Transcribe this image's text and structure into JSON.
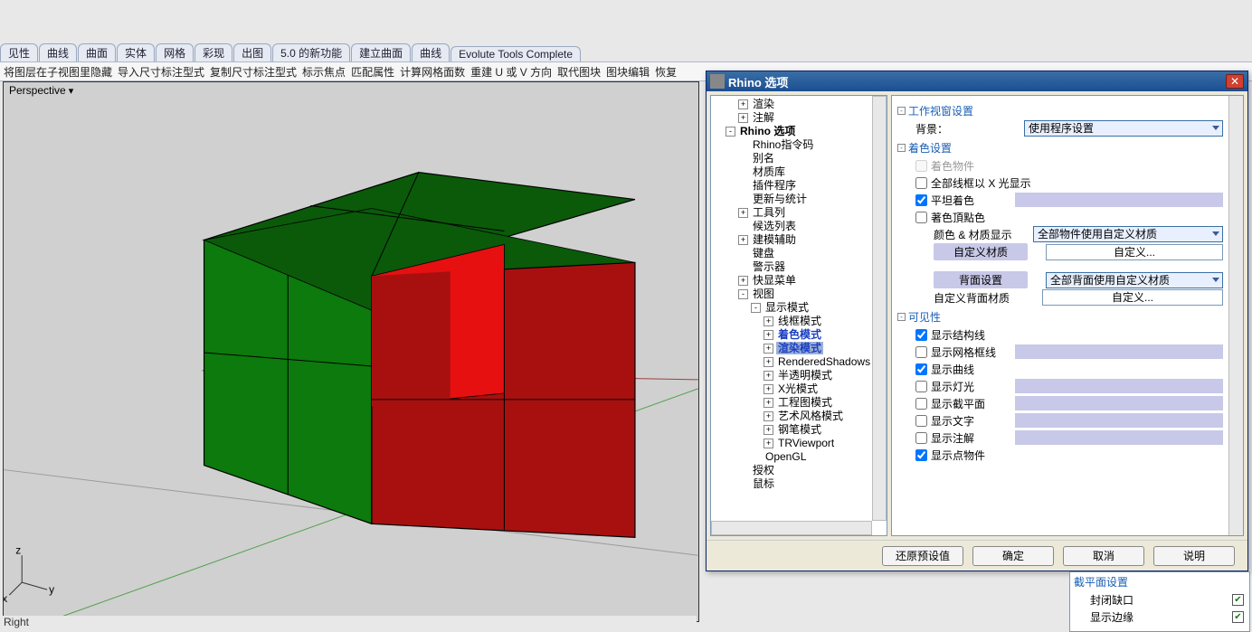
{
  "tabs": [
    "见性",
    "曲线",
    "曲面",
    "实体",
    "网格",
    "彩现",
    "出图",
    "5.0 的新功能",
    "建立曲面",
    "曲线",
    "Evolute Tools Complete"
  ],
  "toolbar": [
    "将图层在子视图里隐藏",
    "导入尺寸标注型式",
    "复制尺寸标注型式",
    "标示焦点",
    "匹配属性",
    "计算网格面数",
    "重建 U 或 V 方向",
    "取代图块",
    "图块编辑",
    "恢复"
  ],
  "viewport_label": "Perspective",
  "dialog": {
    "title": "Rhino 选项",
    "tree": [
      {
        "tw": "+",
        "label": "渲染",
        "depth": 2
      },
      {
        "tw": "+",
        "label": "注解",
        "depth": 2
      },
      {
        "tw": "-",
        "label": "Rhino 选项",
        "depth": 1,
        "bold": true
      },
      {
        "tw": " ",
        "label": "Rhino指令码",
        "depth": 2
      },
      {
        "tw": " ",
        "label": "别名",
        "depth": 2
      },
      {
        "tw": " ",
        "label": "材质库",
        "depth": 2
      },
      {
        "tw": " ",
        "label": "插件程序",
        "depth": 2
      },
      {
        "tw": " ",
        "label": "更新与统计",
        "depth": 2
      },
      {
        "tw": "+",
        "label": "工具列",
        "depth": 2
      },
      {
        "tw": " ",
        "label": "候选列表",
        "depth": 2
      },
      {
        "tw": "+",
        "label": "建模辅助",
        "depth": 2
      },
      {
        "tw": " ",
        "label": "键盘",
        "depth": 2
      },
      {
        "tw": " ",
        "label": "警示器",
        "depth": 2
      },
      {
        "tw": "+",
        "label": "快显菜单",
        "depth": 2
      },
      {
        "tw": "-",
        "label": "视图",
        "depth": 2
      },
      {
        "tw": "-",
        "label": "显示模式",
        "depth": 3
      },
      {
        "tw": "+",
        "label": "线框模式",
        "depth": 4
      },
      {
        "tw": "+",
        "label": "着色模式",
        "depth": 4,
        "blue": true
      },
      {
        "tw": "+",
        "label": "渲染模式",
        "depth": 4,
        "sel": true,
        "blue": true
      },
      {
        "tw": "+",
        "label": "RenderedShadows",
        "depth": 4
      },
      {
        "tw": "+",
        "label": "半透明模式",
        "depth": 4
      },
      {
        "tw": "+",
        "label": "X光模式",
        "depth": 4
      },
      {
        "tw": "+",
        "label": "工程图模式",
        "depth": 4
      },
      {
        "tw": "+",
        "label": "艺术风格模式",
        "depth": 4
      },
      {
        "tw": "+",
        "label": "钢笔模式",
        "depth": 4
      },
      {
        "tw": "+",
        "label": "TRViewport",
        "depth": 4
      },
      {
        "tw": " ",
        "label": "OpenGL",
        "depth": 3
      },
      {
        "tw": " ",
        "label": "授权",
        "depth": 2
      },
      {
        "tw": " ",
        "label": "鼠标",
        "depth": 2
      }
    ],
    "sections": {
      "vp_header": "工作视窗设置",
      "bg_label": "背景：",
      "bg_value": "使用程序设置",
      "shade_header": "着色设置",
      "shade_objects": "着色物件",
      "xray": "全部线框以 X 光显示",
      "flat": "平坦着色",
      "vertex_color": "著色頂點色",
      "col_mat_label": "颜色 & 材质显示",
      "col_mat_value": "全部物件使用自定义材质",
      "custom_mat_label": "自定义材质",
      "custom_btn": "自定义...",
      "back_label": "背面设置",
      "back_value": "全部背面使用自定义材质",
      "custom_back_label": "自定义背面材质",
      "vis_header": "可见性",
      "vis": [
        "显示结构线",
        "显示网格框线",
        "显示曲线",
        "显示灯光",
        "显示截平面",
        "显示文字",
        "显示注解",
        "显示点物件"
      ],
      "vis_checked": [
        true,
        false,
        true,
        false,
        false,
        false,
        false,
        true
      ]
    },
    "buttons": [
      "还原预设值",
      "确定",
      "取消",
      "说明"
    ]
  },
  "extra": {
    "header": "截平面设置",
    "rows": [
      {
        "label": "封闭缺口",
        "checked": true
      },
      {
        "label": "显示边缘",
        "checked": true
      }
    ]
  },
  "status": "Right"
}
